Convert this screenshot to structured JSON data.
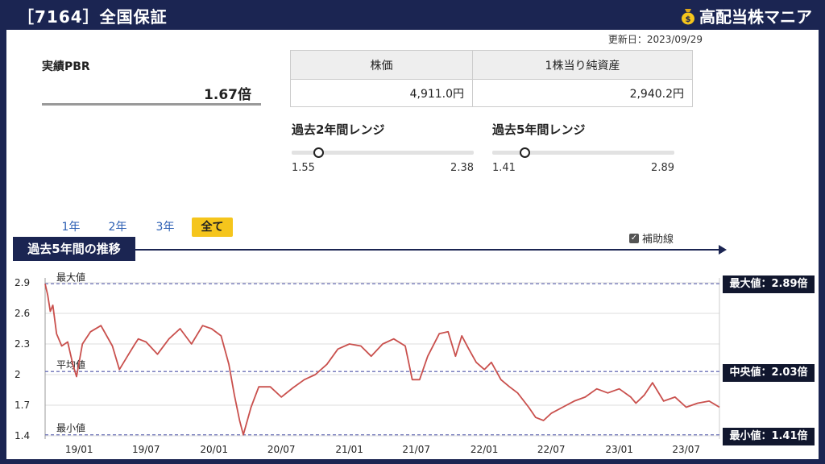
{
  "header": {
    "title": "［7164］全国保証",
    "brand": "高配当株マニア"
  },
  "updated": "更新日：2023/09/29",
  "pbr": {
    "label": "実績PBR",
    "value": "1.67倍"
  },
  "price_table": {
    "headers": [
      "株価",
      "1株当り純資産"
    ],
    "values": [
      "4,911.0円",
      "2,940.2円"
    ]
  },
  "ranges": [
    {
      "title": "過去2年間レンジ",
      "min": "1.55",
      "max": "2.38",
      "current": 1.67
    },
    {
      "title": "過去5年間レンジ",
      "min": "1.41",
      "max": "2.89",
      "current": 1.67
    }
  ],
  "periods": [
    "1年",
    "2年",
    "3年",
    "全て"
  ],
  "active_period": "全て",
  "history_title": "過去5年間の推移",
  "aux_lines_label": "補助線",
  "side_labels": {
    "max": "最大値：2.89倍",
    "median": "中央値：2.03倍",
    "min": "最小値：1.41倍"
  },
  "colors": {
    "navy": "#1b2552",
    "line": "#c9504d",
    "accent": "#f5c51c"
  },
  "chart_data": {
    "type": "line",
    "title": "過去5年間の推移",
    "ylim": [
      1.4,
      2.9
    ],
    "yticks": [
      "1.4",
      "1.7",
      "2",
      "2.3",
      "2.6",
      "2.9"
    ],
    "xticks": [
      "19/01",
      "19/07",
      "20/01",
      "20/07",
      "21/01",
      "21/07",
      "22/01",
      "22/07",
      "23/01",
      "23/07"
    ],
    "ref_lines": [
      {
        "name": "最大値",
        "value": 2.89
      },
      {
        "name": "平均値",
        "value": 2.03
      },
      {
        "name": "最小値",
        "value": 1.41
      }
    ],
    "series": [
      {
        "x": [
          "2018-10-01",
          "2018-10-08",
          "2018-10-15",
          "2018-10-22",
          "2018-11-01",
          "2018-11-15",
          "2018-12-01",
          "2018-12-15",
          "2018-12-25",
          "2019-01-10",
          "2019-02-01",
          "2019-03-01",
          "2019-04-01",
          "2019-04-20",
          "2019-05-15",
          "2019-06-01",
          "2019-06-10",
          "2019-07-01",
          "2019-08-01",
          "2019-09-01",
          "2019-10-01",
          "2019-11-01",
          "2019-12-01",
          "2019-12-25",
          "2020-01-20",
          "2020-02-10",
          "2020-02-25",
          "2020-03-10",
          "2020-03-20",
          "2020-04-10",
          "2020-05-01",
          "2020-06-01",
          "2020-07-01",
          "2020-08-01",
          "2020-09-01",
          "2020-10-01",
          "2020-11-01",
          "2020-12-01",
          "2021-01-01",
          "2021-02-01",
          "2021-03-01",
          "2021-04-01",
          "2021-05-01",
          "2021-06-01",
          "2021-06-20",
          "2021-07-10",
          "2021-08-01",
          "2021-09-01",
          "2021-09-25",
          "2021-10-15",
          "2021-11-01",
          "2021-11-20",
          "2021-12-10",
          "2022-01-01",
          "2022-01-20",
          "2022-02-15",
          "2022-03-10",
          "2022-04-01",
          "2022-05-01",
          "2022-05-20",
          "2022-06-10",
          "2022-07-01",
          "2022-08-01",
          "2022-09-01",
          "2022-10-01",
          "2022-11-01",
          "2022-12-01",
          "2023-01-01",
          "2023-02-01",
          "2023-02-15",
          "2023-03-10",
          "2023-04-01",
          "2023-05-01",
          "2023-06-01",
          "2023-07-01",
          "2023-08-01",
          "2023-09-01",
          "2023-09-29"
        ],
        "y": [
          2.89,
          2.78,
          2.62,
          2.68,
          2.4,
          2.28,
          2.32,
          2.1,
          1.98,
          2.3,
          2.42,
          2.48,
          2.28,
          2.05,
          2.2,
          2.3,
          2.35,
          2.32,
          2.2,
          2.35,
          2.45,
          2.3,
          2.48,
          2.45,
          2.38,
          2.1,
          1.8,
          1.55,
          1.41,
          1.68,
          1.88,
          1.88,
          1.78,
          1.87,
          1.95,
          2.0,
          2.1,
          2.25,
          2.3,
          2.28,
          2.18,
          2.3,
          2.35,
          2.28,
          1.95,
          1.95,
          2.18,
          2.4,
          2.42,
          2.18,
          2.38,
          2.25,
          2.12,
          2.05,
          2.12,
          1.95,
          1.88,
          1.82,
          1.68,
          1.58,
          1.55,
          1.62,
          1.68,
          1.74,
          1.78,
          1.86,
          1.82,
          1.86,
          1.78,
          1.72,
          1.8,
          1.92,
          1.74,
          1.78,
          1.68,
          1.72,
          1.74,
          1.68
        ]
      }
    ]
  }
}
